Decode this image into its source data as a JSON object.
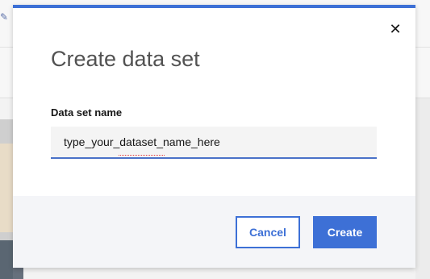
{
  "modal": {
    "title": "Create data set",
    "close_icon": "close-icon",
    "field": {
      "label": "Data set name",
      "value": "type_your_dataset_name_here"
    },
    "buttons": {
      "cancel_label": "Cancel",
      "create_label": "Create"
    }
  },
  "background": {
    "breadcrumb_icon": "pencil-icon"
  },
  "colors": {
    "accent": "#3d70d6",
    "footer_bg": "#f4f5f8",
    "input_bg": "#f4f4f4",
    "title": "#525252"
  }
}
